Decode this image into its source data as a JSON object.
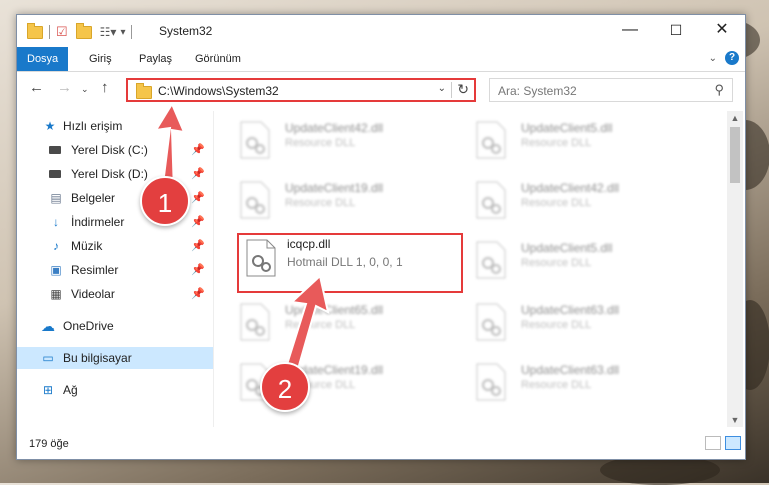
{
  "window": {
    "title": "System32",
    "controls": {
      "minimize": "—",
      "maximize": "☐",
      "close": "✕"
    }
  },
  "ribbon": {
    "tabs": [
      {
        "label": "Dosya",
        "active": true
      },
      {
        "label": "Giriş",
        "active": false
      },
      {
        "label": "Paylaş",
        "active": false
      },
      {
        "label": "Görünüm",
        "active": false
      }
    ],
    "help": "?"
  },
  "address": {
    "path": "C:\\Windows\\System32",
    "search_placeholder": "Ara: System32"
  },
  "sidebar": {
    "items": [
      {
        "label": "Hızlı erişim",
        "icon": "star-icon"
      },
      {
        "label": "Yerel Disk (C:)",
        "icon": "drive-icon",
        "pinned": true
      },
      {
        "label": "Yerel Disk (D:)",
        "icon": "drive-icon",
        "pinned": true
      },
      {
        "label": "Belgeler",
        "icon": "documents-icon",
        "pinned": true
      },
      {
        "label": "İndirmeler",
        "icon": "download-icon",
        "pinned": true
      },
      {
        "label": "Müzik",
        "icon": "music-icon",
        "pinned": true
      },
      {
        "label": "Resimler",
        "icon": "pictures-icon",
        "pinned": true
      },
      {
        "label": "Videolar",
        "icon": "videos-icon",
        "pinned": true
      },
      {
        "label": "OneDrive",
        "icon": "cloud-icon"
      },
      {
        "label": "Bu bilgisayar",
        "icon": "computer-icon",
        "selected": true
      },
      {
        "label": "Ağ",
        "icon": "network-icon"
      }
    ]
  },
  "files": {
    "left": [
      {
        "name": "UpdateClient42.dll",
        "desc": "Resource DLL"
      },
      {
        "name": "UpdateClient19.dll",
        "desc": "Resource DLL"
      },
      {
        "name": "icqcp.dll",
        "desc": "Hotmail DLL 1, 0, 0, 1"
      },
      {
        "name": "UpdateClient65.dll",
        "desc": "Resource DLL"
      },
      {
        "name": "UpdateClient19.dll",
        "desc": "Resource DLL"
      }
    ],
    "right": [
      {
        "name": "UpdateClient5.dll",
        "desc": "Resource DLL"
      },
      {
        "name": "UpdateClient42.dll",
        "desc": "Resource DLL"
      },
      {
        "name": "UpdateClient5.dll",
        "desc": "Resource DLL"
      },
      {
        "name": "UpdateClient63.dll",
        "desc": "Resource DLL"
      },
      {
        "name": "UpdateClient63.dll",
        "desc": "Resource DLL"
      }
    ]
  },
  "status": {
    "count": "179 öğe"
  },
  "annotations": {
    "step1": "1",
    "step2": "2"
  },
  "colors": {
    "accent": "#1979ca",
    "highlight": "#e53a3a",
    "selected": "#cce8ff"
  }
}
